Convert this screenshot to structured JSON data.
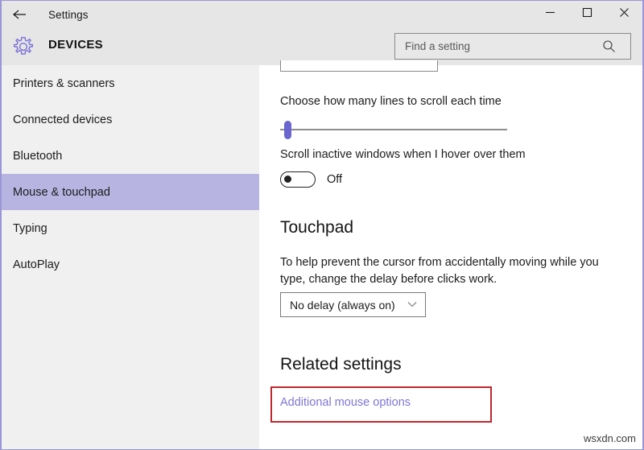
{
  "window": {
    "title": "Settings",
    "back_icon": "back-arrow-icon",
    "controls": {
      "minimize": "minimize-icon",
      "maximize": "maximize-icon",
      "close": "close-icon"
    }
  },
  "header": {
    "icon": "gear-icon",
    "title": "DEVICES"
  },
  "search": {
    "placeholder": "Find a setting",
    "value": "",
    "icon": "search-icon"
  },
  "sidebar": {
    "items": [
      {
        "label": "Printers & scanners",
        "selected": false
      },
      {
        "label": "Connected devices",
        "selected": false
      },
      {
        "label": "Bluetooth",
        "selected": false
      },
      {
        "label": "Mouse & touchpad",
        "selected": true
      },
      {
        "label": "Typing",
        "selected": false
      },
      {
        "label": "AutoPlay",
        "selected": false
      }
    ]
  },
  "main": {
    "scroll_lines": {
      "label": "Choose how many lines to scroll each time",
      "slider_position_percent": 2
    },
    "inactive_scroll": {
      "label": "Scroll inactive windows when I hover over them",
      "state": "Off"
    },
    "touchpad": {
      "heading": "Touchpad",
      "description": "To help prevent the cursor from accidentally moving while you type, change the delay before clicks work.",
      "delay_select": {
        "value": "No delay (always on)",
        "chevron": "chevron-down-icon"
      }
    },
    "related": {
      "heading": "Related settings",
      "link": "Additional mouse options",
      "highlight_color": "#c0272d"
    }
  },
  "watermark": "wsxdn.com",
  "colors": {
    "accent": "#6b65cf",
    "selection": "#b7b4e2",
    "link": "#7d76d6",
    "window_border": "#9a96d8",
    "chrome": "#e6e6e6",
    "sidebar": "#f0f0f0"
  }
}
